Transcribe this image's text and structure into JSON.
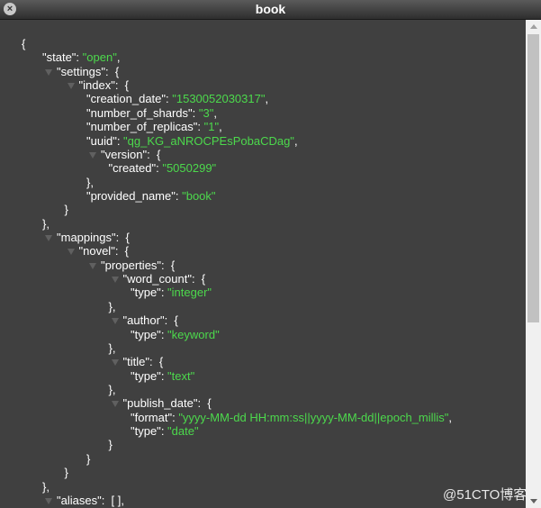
{
  "window": {
    "title": "book",
    "close_icon": "close-icon"
  },
  "watermark": "@51CTO博客",
  "colors": {
    "background": "#404040",
    "string": "#4cd94c",
    "text": "#ffffff"
  },
  "json_lines": [
    {
      "depth": 0,
      "text": "{"
    },
    {
      "depth": 1,
      "key": "\"state\"",
      "value": "\"open\"",
      "suffix": ","
    },
    {
      "depth": 1,
      "key": "\"settings\"",
      "suffix": " {",
      "toggle": true
    },
    {
      "depth": 2,
      "key": "\"index\"",
      "suffix": " {",
      "toggle": true
    },
    {
      "depth": 3,
      "key": "\"creation_date\"",
      "value": "\"1530052030317\"",
      "suffix": ","
    },
    {
      "depth": 3,
      "key": "\"number_of_shards\"",
      "value": "\"3\"",
      "suffix": ","
    },
    {
      "depth": 3,
      "key": "\"number_of_replicas\"",
      "value": "\"1\"",
      "suffix": ","
    },
    {
      "depth": 3,
      "key": "\"uuid\"",
      "value": "\"qg_KG_aNROCPEsPobaCDag\"",
      "suffix": ","
    },
    {
      "depth": 3,
      "key": "\"version\"",
      "suffix": " {",
      "toggle": true
    },
    {
      "depth": 4,
      "key": "\"created\"",
      "value": "\"5050299\""
    },
    {
      "depth": 3,
      "text": "},"
    },
    {
      "depth": 3,
      "key": "\"provided_name\"",
      "value": "\"book\""
    },
    {
      "depth": 2,
      "text": "}"
    },
    {
      "depth": 1,
      "text": "},"
    },
    {
      "depth": 1,
      "key": "\"mappings\"",
      "suffix": " {",
      "toggle": true
    },
    {
      "depth": 2,
      "key": "\"novel\"",
      "suffix": " {",
      "toggle": true
    },
    {
      "depth": 3,
      "key": "\"properties\"",
      "suffix": " {",
      "toggle": true
    },
    {
      "depth": 4,
      "key": "\"word_count\"",
      "suffix": " {",
      "toggle": true
    },
    {
      "depth": 5,
      "key": "\"type\"",
      "value": "\"integer\""
    },
    {
      "depth": 4,
      "text": "},"
    },
    {
      "depth": 4,
      "key": "\"author\"",
      "suffix": " {",
      "toggle": true
    },
    {
      "depth": 5,
      "key": "\"type\"",
      "value": "\"keyword\""
    },
    {
      "depth": 4,
      "text": "},"
    },
    {
      "depth": 4,
      "key": "\"title\"",
      "suffix": " {",
      "toggle": true
    },
    {
      "depth": 5,
      "key": "\"type\"",
      "value": "\"text\""
    },
    {
      "depth": 4,
      "text": "},"
    },
    {
      "depth": 4,
      "key": "\"publish_date\"",
      "suffix": " {",
      "toggle": true
    },
    {
      "depth": 5,
      "key": "\"format\"",
      "value": "\"yyyy-MM-dd HH:mm:ss||yyyy-MM-dd||epoch_millis\"",
      "suffix": ","
    },
    {
      "depth": 5,
      "key": "\"type\"",
      "value": "\"date\""
    },
    {
      "depth": 4,
      "text": "}"
    },
    {
      "depth": 3,
      "text": "}"
    },
    {
      "depth": 2,
      "text": "}"
    },
    {
      "depth": 1,
      "text": "},"
    },
    {
      "depth": 1,
      "key": "\"aliases\"",
      "suffix": " [ ],",
      "toggle": true
    }
  ]
}
